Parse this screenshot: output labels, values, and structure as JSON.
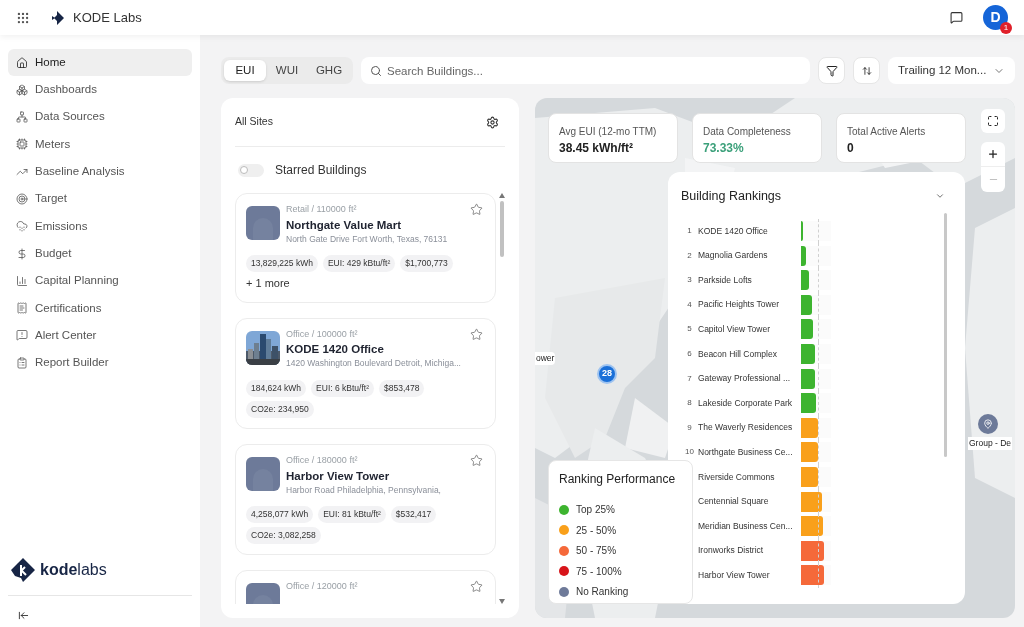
{
  "top_bar": {
    "app_name": "KODE Labs",
    "avatar": "D",
    "notification_count": "1"
  },
  "sidebar": {
    "items": [
      {
        "label": "Home",
        "selected": true
      },
      {
        "label": "Dashboards",
        "selected": false
      },
      {
        "label": "Data Sources",
        "selected": false
      },
      {
        "label": "Meters",
        "selected": false
      },
      {
        "label": "Baseline Analysis",
        "selected": false
      },
      {
        "label": "Target",
        "selected": false
      },
      {
        "label": "Emissions",
        "selected": false
      },
      {
        "label": "Budget",
        "selected": false
      },
      {
        "label": "Capital Planning",
        "selected": false
      },
      {
        "label": "Certifications",
        "selected": false
      },
      {
        "label": "Alert Center",
        "selected": false
      },
      {
        "label": "Report Builder",
        "selected": false
      }
    ],
    "logo": {
      "bold": "kode",
      "light": "labs"
    }
  },
  "toolbar": {
    "tabs": [
      {
        "label": "EUI",
        "selected": true
      },
      {
        "label": "WUI",
        "selected": false
      },
      {
        "label": "GHG",
        "selected": false
      }
    ],
    "search": {
      "placeholder": "Search Buildings..."
    },
    "period": "Trailing 12 Mon..."
  },
  "sites_panel": {
    "title": "All Sites",
    "starred_toggle": {
      "label": "Starred Buildings",
      "on": false
    },
    "buildings": [
      {
        "category": "Retail / 110000 ft²",
        "name": "Northgate Value Mart",
        "address": "North Gate Drive Fort Worth, Texas, 76131",
        "kind": "placeholder",
        "starred": false,
        "tags": [
          "13,829,225 kWh",
          "EUI: 429 kBtu/ft²",
          "$1,700,773"
        ],
        "more": "+ 1 more"
      },
      {
        "category": "Office / 100000 ft²",
        "name": "KODE 1420 Office",
        "address": "1420 Washington Boulevard Detroit, Michiga...",
        "kind": "picture",
        "starred": false,
        "tags": [
          "184,624 kWh",
          "EUI: 6 kBtu/ft²",
          "$853,478",
          "CO2e: 234,950"
        ]
      },
      {
        "category": "Office / 180000 ft²",
        "name": "Harbor View Tower",
        "address": "Harbor Road Philadelphia, Pennsylvania,",
        "kind": "placeholder",
        "starred": false,
        "tags": [
          "4,258,077 kWh",
          "EUI: 81 kBtu/ft²",
          "$532,417",
          "CO2e: 3,082,258"
        ]
      },
      {
        "category": "Office / 120000 ft²",
        "kind": "placeholder",
        "starred": false
      }
    ]
  },
  "map": {
    "stats": [
      {
        "label": "Avg EUI (12-mo TTM)",
        "value": "38.45 kWh/ft²",
        "highlight": false
      },
      {
        "label": "Data Completeness",
        "value": "73.33%",
        "highlight": true
      },
      {
        "label": "Total Active Alerts",
        "value": "0",
        "highlight": false
      }
    ],
    "cluster": "28",
    "marker_label": "ower",
    "group_label": "Group - De",
    "rankings": {
      "title": "Building Rankings",
      "rows": [
        {
          "rank": "1",
          "name": "KODE 1420 Office",
          "level": 0.07,
          "color": "#3db42f"
        },
        {
          "rank": "2",
          "name": "Magnolia Gardens",
          "level": 0.17,
          "color": "#3db42f"
        },
        {
          "rank": "3",
          "name": "Parkside Lofts",
          "level": 0.27,
          "color": "#3db42f"
        },
        {
          "rank": "4",
          "name": "Pacific Heights Tower",
          "level": 0.37,
          "color": "#3db42f"
        },
        {
          "rank": "5",
          "name": "Capitol View Tower",
          "level": 0.4,
          "color": "#3db42f"
        },
        {
          "rank": "6",
          "name": "Beacon Hill Complex",
          "level": 0.47,
          "color": "#3db42f"
        },
        {
          "rank": "7",
          "name": "Gateway Professional ...",
          "level": 0.47,
          "color": "#3db42f"
        },
        {
          "rank": "8",
          "name": "Lakeside Corporate Park",
          "level": 0.5,
          "color": "#3db42f"
        },
        {
          "rank": "9",
          "name": "The Waverly Residences",
          "level": 0.57,
          "color": "#f9a01b"
        },
        {
          "rank": "10",
          "name": "Northgate Business Ce...",
          "level": 0.57,
          "color": "#f9a01b"
        },
        {
          "name": "Riverside Commons",
          "level": 0.57,
          "color": "#f9a01b"
        },
        {
          "name": "Centennial Square",
          "level": 0.7,
          "color": "#f9a01b"
        },
        {
          "name": "Meridian Business Cen...",
          "level": 0.73,
          "color": "#f9a01b"
        },
        {
          "name": "Ironworks District",
          "level": 0.77,
          "color": "#f5693a"
        },
        {
          "name": "Harbor View Tower",
          "level": 0.77,
          "color": "#f5693a"
        }
      ]
    },
    "legend": {
      "title": "Ranking Performance",
      "items": [
        {
          "label": "Top 25%",
          "color": "#3db42f"
        },
        {
          "label": "25 - 50%",
          "color": "#f9a01b"
        },
        {
          "label": "50 - 75%",
          "color": "#f5693a"
        },
        {
          "label": "75 - 100%",
          "color": "#d7141a"
        },
        {
          "label": "No Ranking",
          "color": "#6e7a99"
        }
      ]
    }
  }
}
